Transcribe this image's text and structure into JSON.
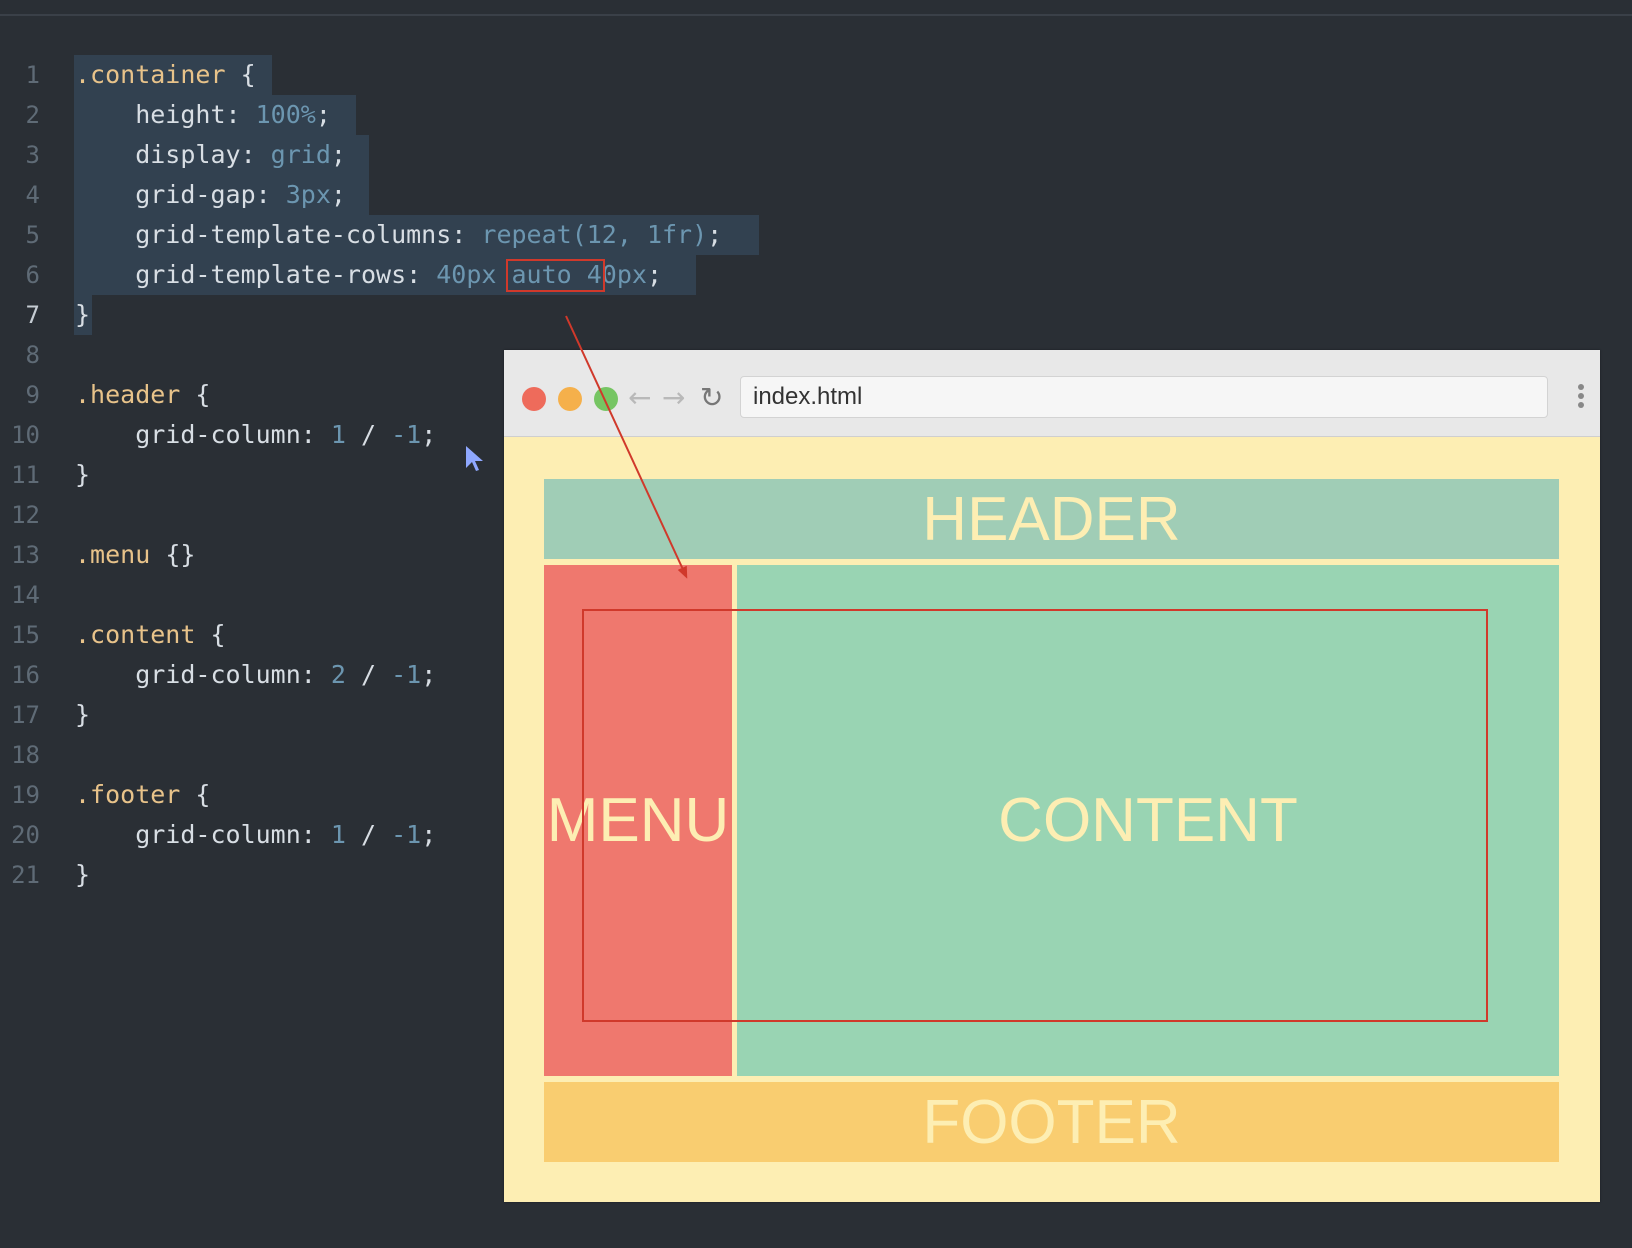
{
  "editor": {
    "lines": [
      {
        "num": "1",
        "parts": [
          {
            "t": ".container",
            "c": "sel"
          },
          {
            "t": " {",
            "c": "punc"
          }
        ]
      },
      {
        "num": "2",
        "parts": [
          {
            "t": "    height: ",
            "c": "prop"
          },
          {
            "t": "100%",
            "c": "val"
          },
          {
            "t": ";",
            "c": "punc"
          }
        ]
      },
      {
        "num": "3",
        "parts": [
          {
            "t": "    display: ",
            "c": "prop"
          },
          {
            "t": "grid",
            "c": "val"
          },
          {
            "t": ";",
            "c": "punc"
          }
        ]
      },
      {
        "num": "4",
        "parts": [
          {
            "t": "    grid-gap: ",
            "c": "prop"
          },
          {
            "t": "3px",
            "c": "val"
          },
          {
            "t": ";",
            "c": "punc"
          }
        ]
      },
      {
        "num": "5",
        "parts": [
          {
            "t": "    grid-template-columns: ",
            "c": "prop"
          },
          {
            "t": "repeat(12, 1fr)",
            "c": "val"
          },
          {
            "t": ";",
            "c": "punc"
          }
        ]
      },
      {
        "num": "6",
        "parts": [
          {
            "t": "    grid-template-rows: ",
            "c": "prop"
          },
          {
            "t": "40px auto 40px",
            "c": "val"
          },
          {
            "t": ";",
            "c": "punc"
          }
        ]
      },
      {
        "num": "7",
        "parts": [
          {
            "t": "}",
            "c": "punc"
          }
        ]
      },
      {
        "num": "8",
        "parts": []
      },
      {
        "num": "9",
        "parts": [
          {
            "t": ".header",
            "c": "sel"
          },
          {
            "t": " {",
            "c": "punc"
          }
        ]
      },
      {
        "num": "10",
        "parts": [
          {
            "t": "    grid-column: ",
            "c": "prop"
          },
          {
            "t": "1",
            "c": "val"
          },
          {
            "t": " / ",
            "c": "punc"
          },
          {
            "t": "-1",
            "c": "val"
          },
          {
            "t": ";",
            "c": "punc"
          }
        ]
      },
      {
        "num": "11",
        "parts": [
          {
            "t": "}",
            "c": "punc"
          }
        ]
      },
      {
        "num": "12",
        "parts": []
      },
      {
        "num": "13",
        "parts": [
          {
            "t": ".menu",
            "c": "sel"
          },
          {
            "t": " {}",
            "c": "punc"
          }
        ]
      },
      {
        "num": "14",
        "parts": []
      },
      {
        "num": "15",
        "parts": [
          {
            "t": ".content",
            "c": "sel"
          },
          {
            "t": " {",
            "c": "punc"
          }
        ]
      },
      {
        "num": "16",
        "parts": [
          {
            "t": "    grid-column: ",
            "c": "prop"
          },
          {
            "t": "2",
            "c": "val"
          },
          {
            "t": " / ",
            "c": "punc"
          },
          {
            "t": "-1",
            "c": "val"
          },
          {
            "t": ";",
            "c": "punc"
          }
        ]
      },
      {
        "num": "17",
        "parts": [
          {
            "t": "}",
            "c": "punc"
          }
        ]
      },
      {
        "num": "18",
        "parts": []
      },
      {
        "num": "19",
        "parts": [
          {
            "t": ".footer",
            "c": "sel"
          },
          {
            "t": " {",
            "c": "punc"
          }
        ]
      },
      {
        "num": "20",
        "parts": [
          {
            "t": "    grid-column: ",
            "c": "prop"
          },
          {
            "t": "1",
            "c": "val"
          },
          {
            "t": " / ",
            "c": "punc"
          },
          {
            "t": "-1",
            "c": "val"
          },
          {
            "t": ";",
            "c": "punc"
          }
        ]
      },
      {
        "num": "21",
        "parts": [
          {
            "t": "}",
            "c": "punc"
          }
        ]
      }
    ],
    "active_line": "7"
  },
  "browser": {
    "url": "index.html",
    "buttons": {
      "close": "close-window",
      "minimize": "minimize-window",
      "maximize": "maximize-window",
      "back": "←",
      "forward": "→",
      "reload": "↻"
    }
  },
  "page": {
    "header": "HEADER",
    "menu": "MENU",
    "content": "CONTENT",
    "footer": "FOOTER"
  },
  "colors": {
    "editor_bg": "#2a2f35",
    "selector": "#e8c38a",
    "value": "#6c96b0",
    "header_bg": "#a0cdb6",
    "menu_bg": "#ef786e",
    "content_bg": "#99d4b3",
    "footer_bg": "#f9cd70",
    "page_bg": "#fdeeb3",
    "annotation": "#d0392b"
  }
}
